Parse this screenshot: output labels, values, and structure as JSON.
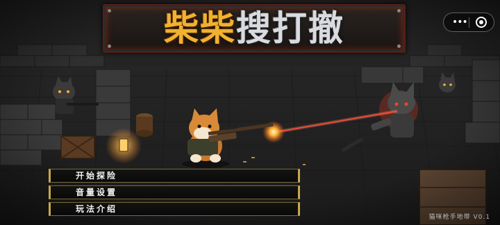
{
  "title": {
    "part1": "柴柴",
    "part2": "搜打撤"
  },
  "capsule": {
    "more_icon": "more-dots-icon",
    "close_icon": "target-circle-icon"
  },
  "menu": [
    {
      "label": "开始探险"
    },
    {
      "label": "音量设置"
    },
    {
      "label": "玩法介绍"
    }
  ],
  "version_text": "猫咪枪手地带 V0.1",
  "colors": {
    "accent_gold": "#c8a94a",
    "title_orange": "#f0b22f",
    "laser": "#ff3a2a"
  }
}
